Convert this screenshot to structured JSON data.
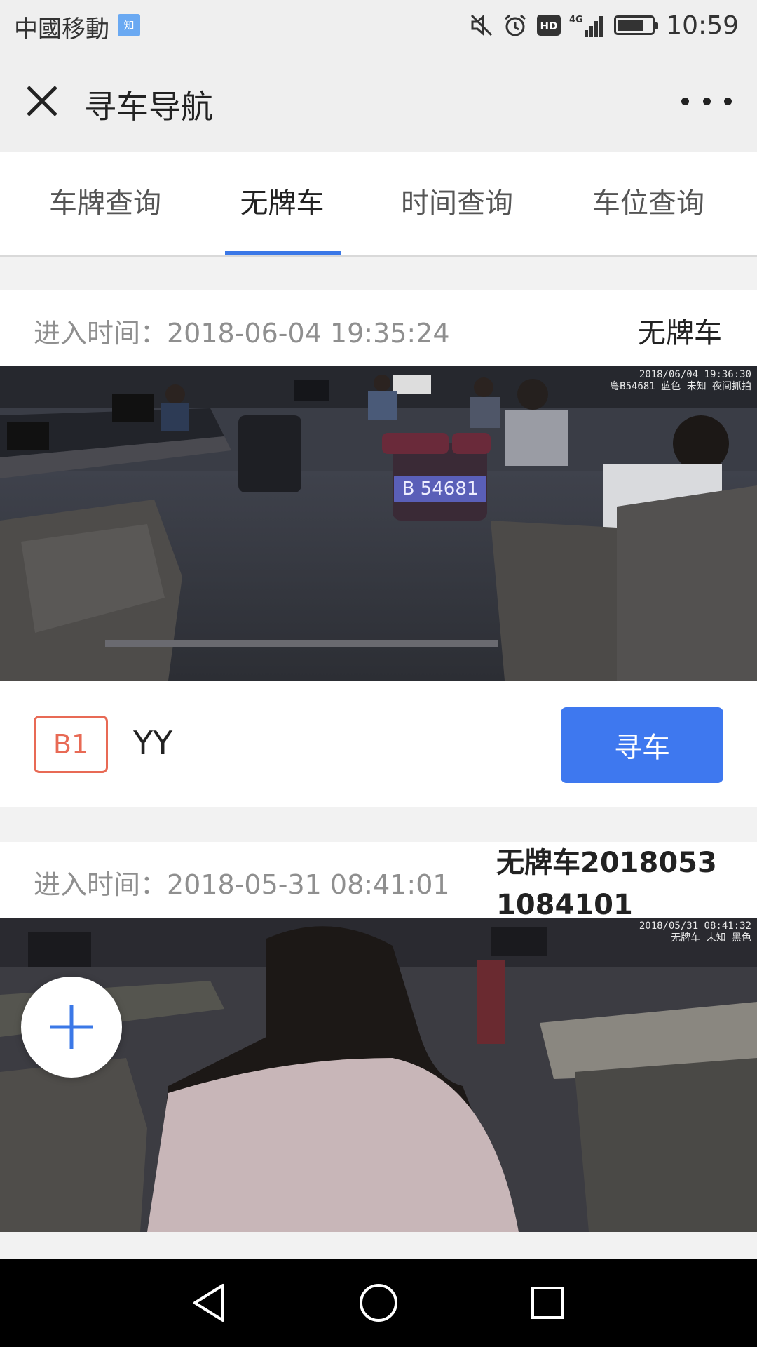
{
  "status_bar": {
    "carrier": "中國移動",
    "carrier_badge": "知",
    "network": "4G",
    "hd": "HD",
    "time": "10:59",
    "battery_level": 0.75,
    "icons": [
      "mute-icon",
      "alarm-icon",
      "hd-icon",
      "signal-icon",
      "battery-icon"
    ]
  },
  "title_bar": {
    "title": "寻车导航",
    "close_icon": "close-icon",
    "more_icon": "more-icon"
  },
  "tabs": [
    {
      "label": "车牌查询",
      "active": false
    },
    {
      "label": "无牌车",
      "active": true
    },
    {
      "label": "时间查询",
      "active": false
    },
    {
      "label": "车位查询",
      "active": false
    }
  ],
  "accent_color": "#3b78e7",
  "records": [
    {
      "entry_time": "进入时间：2018-06-04 19:35:24",
      "plate_label": "无牌车",
      "photo_plate": "B 54681",
      "camera_stamp": [
        "2018/06/04 19:36:30",
        "粤B54681 蓝色 未知 夜间抓拍"
      ],
      "floor": "B1",
      "spot": "YY",
      "button": "寻车"
    },
    {
      "entry_time": "进入时间：2018-05-31 08:41:01",
      "plate_label": "无牌车20180531084101",
      "camera_stamp": [
        "2018/05/31 08:41:32",
        "无牌车 未知 黑色"
      ]
    }
  ],
  "fab_icon": "plus-icon",
  "nav_bar": {
    "icons": [
      "back-icon",
      "home-icon",
      "recents-icon"
    ]
  }
}
